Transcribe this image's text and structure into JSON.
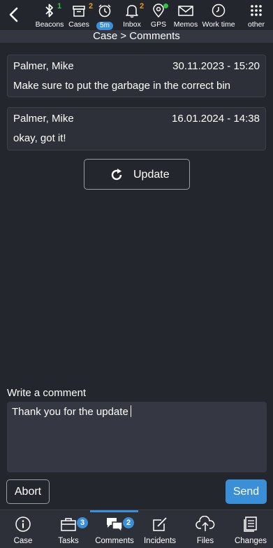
{
  "toolbar": {
    "items": [
      {
        "label": "Beacons",
        "badge": "1",
        "icon": "bluetooth-icon"
      },
      {
        "label": "Cases",
        "badge": "2",
        "icon": "cases-icon"
      },
      {
        "label": "5m",
        "icon": "alarm-clock-icon"
      },
      {
        "label": "Inbox",
        "badge": "2",
        "icon": "bell-icon"
      },
      {
        "label": "GPS",
        "icon": "location-pin-icon"
      },
      {
        "label": "Memos",
        "icon": "envelope-icon"
      },
      {
        "label": "Work time",
        "icon": "clock-icon"
      },
      {
        "label": "other",
        "icon": "grid-icon"
      }
    ],
    "colors": {
      "badge_green": "#36c24a",
      "badge_orange": "#e89a2a"
    }
  },
  "breadcrumb": "Case > Comments",
  "comments": [
    {
      "author": "Palmer, Mike",
      "date": "30.11.2023 - 15:20",
      "text": "Make sure to put the garbage in the correct bin"
    },
    {
      "author": "Palmer, Mike",
      "date": "16.01.2024 - 14:38",
      "text": "okay, got it!"
    }
  ],
  "update_label": "Update",
  "compose": {
    "label": "Write a comment",
    "value": "Thank you for the update",
    "abort_label": "Abort",
    "send_label": "Send"
  },
  "bottom_nav": {
    "items": [
      {
        "label": "Case",
        "icon": "info-icon"
      },
      {
        "label": "Tasks",
        "badge": "3",
        "icon": "briefcase-icon"
      },
      {
        "label": "Comments",
        "badge": "2",
        "icon": "comments-icon",
        "active": true
      },
      {
        "label": "Incidents",
        "icon": "edit-icon"
      },
      {
        "label": "Files",
        "icon": "cloud-upload-icon"
      },
      {
        "label": "Changes",
        "icon": "document-icon"
      }
    ]
  },
  "colors": {
    "accent": "#3b8fd6",
    "background": "#24262d",
    "card": "#2d3039"
  }
}
